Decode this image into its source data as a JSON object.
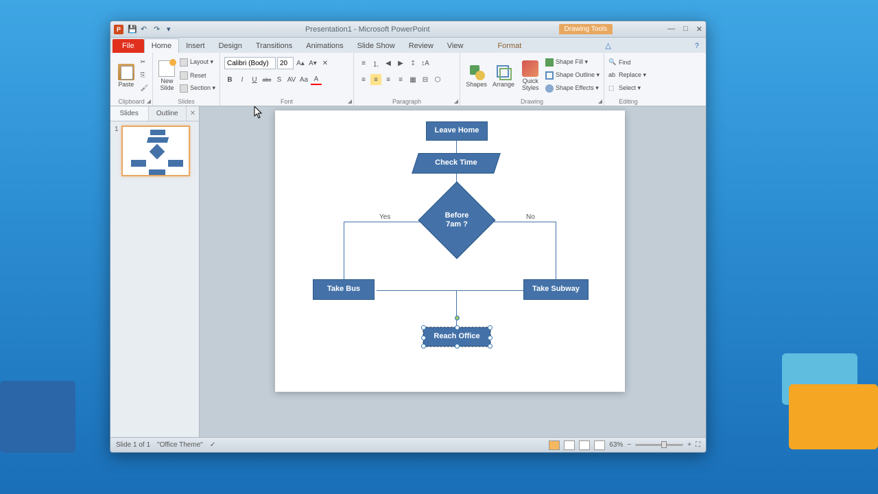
{
  "window": {
    "title": "Presentation1 - Microsoft PowerPoint",
    "context_tab_group": "Drawing Tools",
    "minimize": "—",
    "maximize": "□",
    "close": "✕"
  },
  "qat": {
    "save": "💾",
    "undo": "↶",
    "redo": "↷",
    "repeat": "⟳",
    "more": "▾"
  },
  "tabs": {
    "file": "File",
    "home": "Home",
    "insert": "Insert",
    "design": "Design",
    "transitions": "Transitions",
    "animations": "Animations",
    "slideshow": "Slide Show",
    "review": "Review",
    "view": "View",
    "format": "Format"
  },
  "ribbon": {
    "clipboard": {
      "label": "Clipboard",
      "paste": "Paste",
      "cut": "✂",
      "copy": "⎘",
      "fmt": "🖌"
    },
    "slides": {
      "label": "Slides",
      "new_slide": "New\nSlide",
      "layout": "Layout ▾",
      "reset": "Reset",
      "section": "Section ▾"
    },
    "font": {
      "label": "Font",
      "name": "Calibri (Body)",
      "size": "20",
      "grow": "A▴",
      "shrink": "A▾",
      "clear": "A✕",
      "bold": "B",
      "italic": "I",
      "underline": "U",
      "strike": "abc",
      "shadow": "S",
      "spacing": "AV",
      "case": "Aa",
      "color": "A"
    },
    "paragraph": {
      "label": "Paragraph"
    },
    "drawing": {
      "label": "Drawing",
      "shapes": "Shapes",
      "arrange": "Arrange",
      "quick_styles": "Quick\nStyles",
      "fill": "Shape Fill ▾",
      "outline": "Shape Outline ▾",
      "effects": "Shape Effects ▾"
    },
    "editing": {
      "label": "Editing",
      "find": "Find",
      "replace": "Replace ▾",
      "select": "Select ▾"
    }
  },
  "sidepanel": {
    "slides_tab": "Slides",
    "outline_tab": "Outline",
    "close": "✕",
    "slide_num": "1"
  },
  "flowchart": {
    "leave_home": "Leave Home",
    "check_time": "Check Time",
    "before_7am": "Before\n7am ?",
    "yes": "Yes",
    "no": "No",
    "take_bus": "Take Bus",
    "take_subway": "Take Subway",
    "reach_office": "Reach Office"
  },
  "statusbar": {
    "slide_info": "Slide 1 of 1",
    "theme": "\"Office Theme\"",
    "zoom": "63%",
    "zoom_out": "−",
    "zoom_in": "+",
    "fit": "⛶"
  },
  "chart_data": {
    "type": "flowchart",
    "nodes": [
      {
        "id": "leave_home",
        "type": "terminator",
        "label": "Leave Home"
      },
      {
        "id": "check_time",
        "type": "data",
        "label": "Check Time"
      },
      {
        "id": "before_7am",
        "type": "decision",
        "label": "Before 7am ?"
      },
      {
        "id": "take_bus",
        "type": "process",
        "label": "Take Bus"
      },
      {
        "id": "take_subway",
        "type": "process",
        "label": "Take Subway"
      },
      {
        "id": "reach_office",
        "type": "process",
        "label": "Reach Office"
      }
    ],
    "edges": [
      {
        "from": "leave_home",
        "to": "check_time"
      },
      {
        "from": "check_time",
        "to": "before_7am"
      },
      {
        "from": "before_7am",
        "to": "take_bus",
        "label": "Yes"
      },
      {
        "from": "before_7am",
        "to": "take_subway",
        "label": "No"
      },
      {
        "from": "take_bus",
        "to": "reach_office"
      },
      {
        "from": "take_subway",
        "to": "reach_office"
      }
    ]
  }
}
